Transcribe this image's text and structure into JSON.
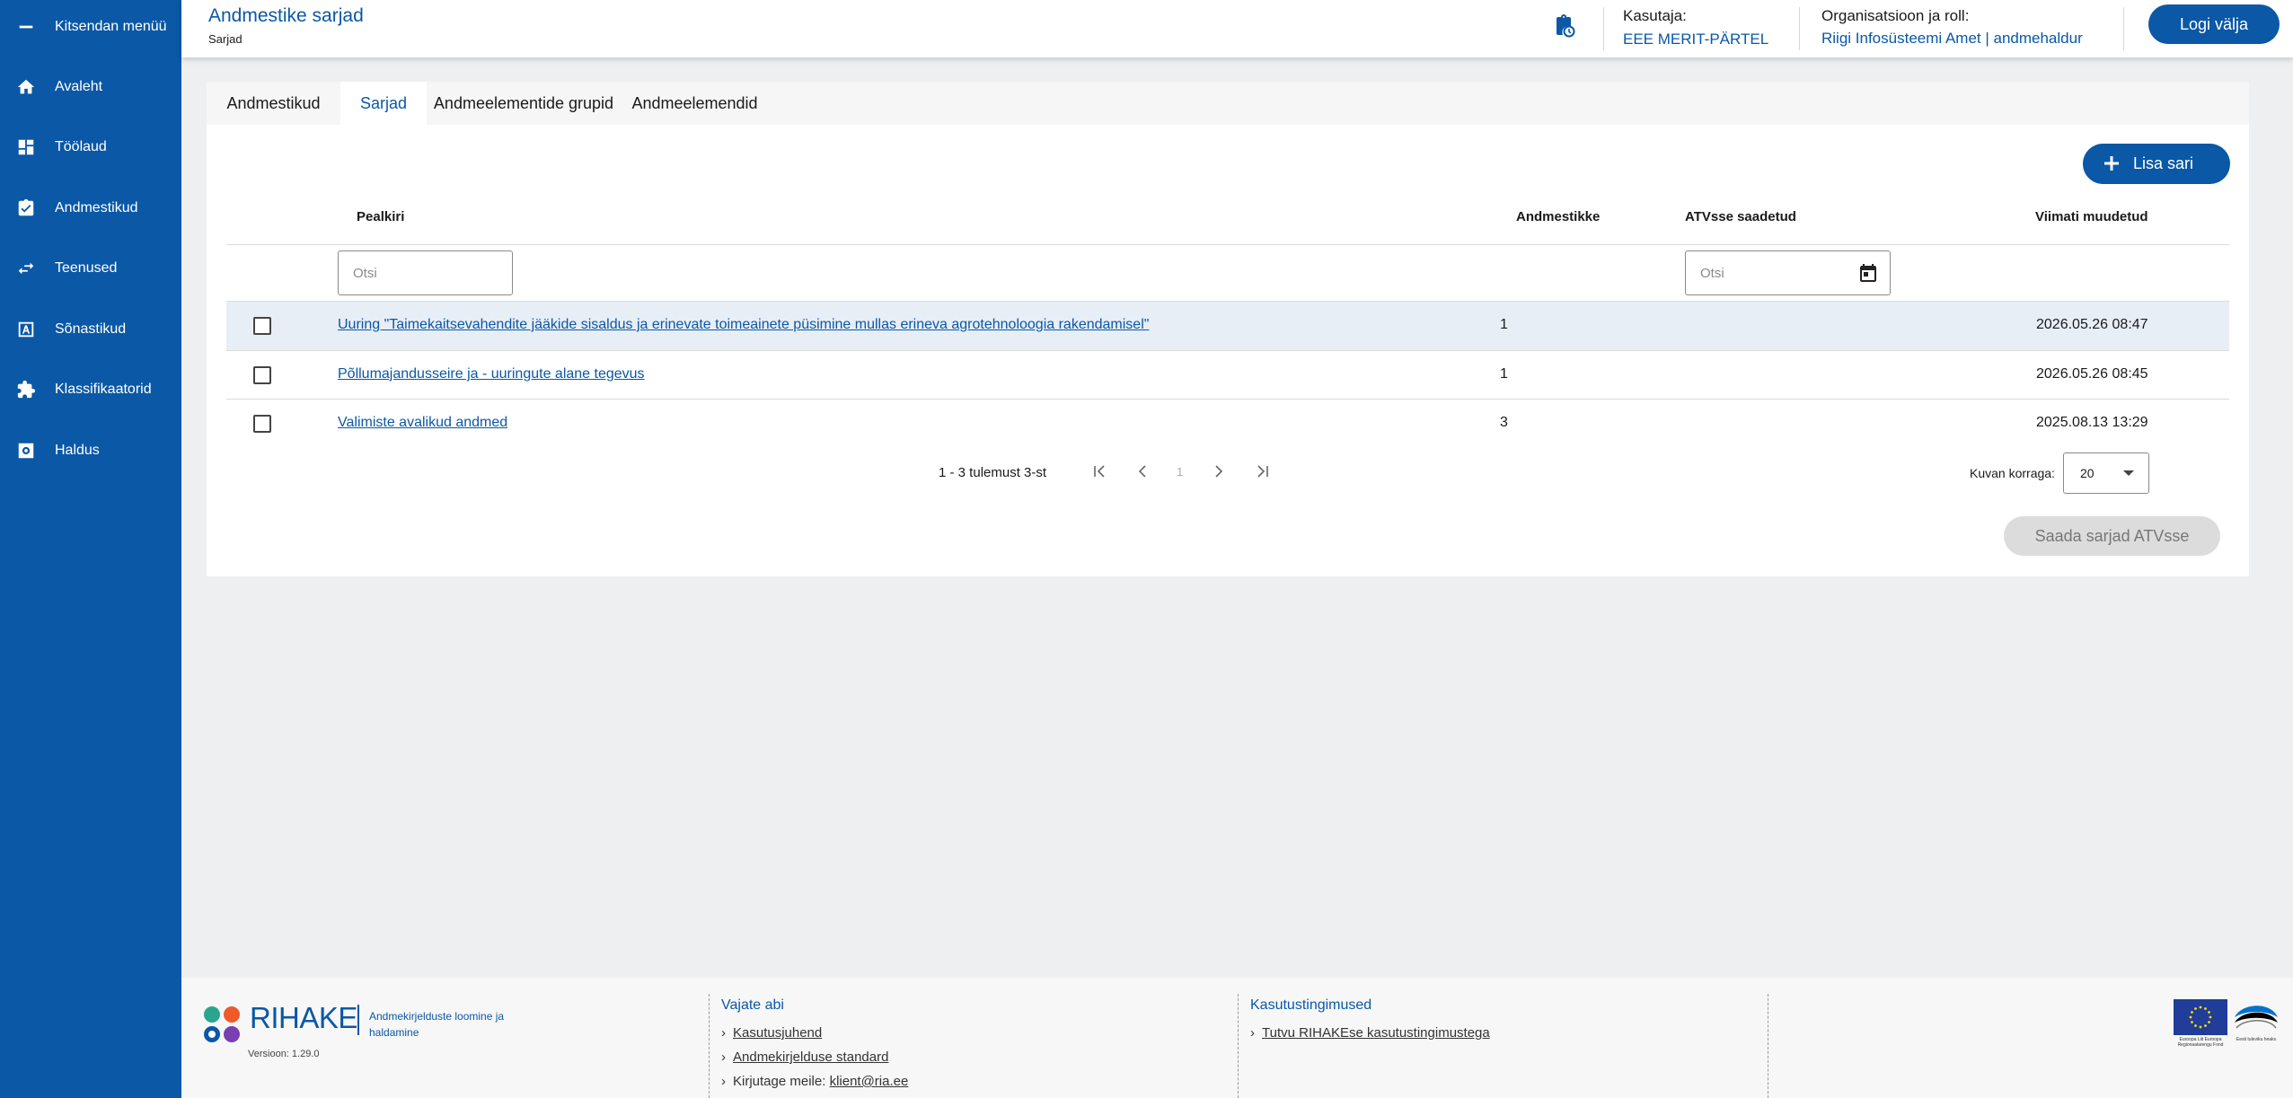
{
  "sidebar": {
    "items": [
      {
        "label": "Kitsendan menüü",
        "icon": "minus-icon"
      },
      {
        "label": "Avaleht",
        "icon": "home-icon"
      },
      {
        "label": "Töölaud",
        "icon": "dashboard-icon"
      },
      {
        "label": "Andmestikud",
        "icon": "clipboard-check-icon"
      },
      {
        "label": "Teenused",
        "icon": "swap-arrows-icon"
      },
      {
        "label": "Sõnastikud",
        "icon": "dictionary-icon"
      },
      {
        "label": "Klassifikaatorid",
        "icon": "puzzle-icon"
      },
      {
        "label": "Haldus",
        "icon": "settings-icon"
      }
    ]
  },
  "header": {
    "title": "Andmestike sarjad",
    "subtitle": "Sarjad",
    "user_label": "Kasutaja:",
    "user_name": "EEE MERIT-PÄRTEL",
    "org_label": "Organisatsioon ja roll:",
    "org_value": "Riigi Infosüsteemi Amet | andmehaldur",
    "logout": "Logi välja"
  },
  "tabs": [
    "Andmestikud",
    "Sarjad",
    "Andmeelementide grupid",
    "Andmeelemendid"
  ],
  "active_tab": "Sarjad",
  "toolbar": {
    "add_label": "Lisa sari"
  },
  "table": {
    "headers": {
      "title": "Pealkiri",
      "count": "Andmestikke",
      "sent": "ATVsse saadetud",
      "modified": "Viimati muudetud"
    },
    "search_placeholder": "Otsi",
    "date_placeholder": "Otsi",
    "rows": [
      {
        "title": "Uuring \"Taimekaitsevahendite jääkide sisaldus ja erinevate toimeainete püsimine mullas erineva agrotehnoloogia rakendamisel\"",
        "count": "1",
        "sent": "",
        "modified": "2026.05.26 08:47"
      },
      {
        "title": "Põllumajandusseire ja - uuringute alane tegevus",
        "count": "1",
        "sent": "",
        "modified": "2026.05.26 08:45"
      },
      {
        "title": "Valimiste avalikud andmed",
        "count": "3",
        "sent": "",
        "modified": "2025.08.13 13:29"
      }
    ]
  },
  "pagination": {
    "info": "1 - 3 tulemust 3-st",
    "page": "1",
    "per_page_label": "Kuvan korraga:",
    "per_page_value": "20"
  },
  "send_button": "Saada sarjad ATVsse",
  "footer": {
    "logo_text": "RIHAKE",
    "logo_desc": "Andmekirjelduste loomine ja haldamine",
    "version": "Versioon: 1.29.0",
    "help_title": "Vajate abi",
    "help_links": [
      "Kasutusjuhend",
      "Andmekirjelduse standard"
    ],
    "mail_prefix": "Kirjutage meile:",
    "mail_link": "klient@ria.ee",
    "terms_title": "Kasutustingimused",
    "terms_link": "Tutvu RIHAKEse kasutustingimustega",
    "eu_text": "Euroopa Liit Euroopa Regionaalarengu Fond",
    "est_text": "Eesti tuleviku heaks"
  },
  "colors": {
    "primary": "#0a58a6",
    "row_highlight": "#e8eef6",
    "disabled": "#dcdcdc"
  }
}
